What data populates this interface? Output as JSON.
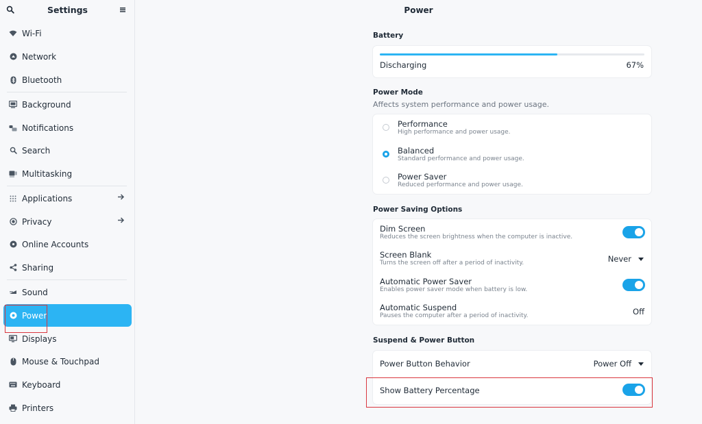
{
  "sidebar": {
    "title": "Settings",
    "items": [
      {
        "id": "wifi",
        "label": "Wi-Fi",
        "icon": "wifi-icon"
      },
      {
        "id": "network",
        "label": "Network",
        "icon": "network-icon"
      },
      {
        "id": "bluetooth",
        "label": "Bluetooth",
        "icon": "bluetooth-icon"
      },
      {
        "id": "background",
        "label": "Background",
        "icon": "background-icon"
      },
      {
        "id": "notifications",
        "label": "Notifications",
        "icon": "notifications-icon"
      },
      {
        "id": "search",
        "label": "Search",
        "icon": "search-icon"
      },
      {
        "id": "multitasking",
        "label": "Multitasking",
        "icon": "multitasking-icon"
      },
      {
        "id": "applications",
        "label": "Applications",
        "icon": "applications-icon"
      },
      {
        "id": "privacy",
        "label": "Privacy",
        "icon": "privacy-icon"
      },
      {
        "id": "online-accounts",
        "label": "Online Accounts",
        "icon": "online-accounts-icon"
      },
      {
        "id": "sharing",
        "label": "Sharing",
        "icon": "sharing-icon"
      },
      {
        "id": "sound",
        "label": "Sound",
        "icon": "sound-icon"
      },
      {
        "id": "power",
        "label": "Power",
        "icon": "power-icon",
        "active": true
      },
      {
        "id": "displays",
        "label": "Displays",
        "icon": "displays-icon"
      },
      {
        "id": "mouse",
        "label": "Mouse & Touchpad",
        "icon": "mouse-icon"
      },
      {
        "id": "keyboard",
        "label": "Keyboard",
        "icon": "keyboard-icon"
      },
      {
        "id": "printers",
        "label": "Printers",
        "icon": "printer-icon"
      }
    ]
  },
  "main": {
    "title": "Power",
    "battery": {
      "section_title": "Battery",
      "status": "Discharging",
      "percent_label": "67%",
      "level": 0.67
    },
    "power_mode": {
      "section_title": "Power Mode",
      "subtitle": "Affects system performance and power usage.",
      "options": [
        {
          "label": "Performance",
          "desc": "High performance and power usage.",
          "selected": false
        },
        {
          "label": "Balanced",
          "desc": "Standard performance and power usage.",
          "selected": true
        },
        {
          "label": "Power Saver",
          "desc": "Reduced performance and power usage.",
          "selected": false
        }
      ]
    },
    "saving": {
      "section_title": "Power Saving Options",
      "dim_screen": {
        "title": "Dim Screen",
        "desc": "Reduces the screen brightness when the computer is inactive.",
        "on": true
      },
      "screen_blank": {
        "title": "Screen Blank",
        "desc": "Turns the screen off after a period of inactivity.",
        "value": "Never"
      },
      "auto_saver": {
        "title": "Automatic Power Saver",
        "desc": "Enables power saver mode when battery is low.",
        "on": true
      },
      "auto_suspend": {
        "title": "Automatic Suspend",
        "desc": "Pauses the computer after a period of inactivity.",
        "value": "Off"
      }
    },
    "suspend": {
      "section_title": "Suspend & Power Button",
      "button_behavior": {
        "title": "Power Button Behavior",
        "value": "Power Off"
      },
      "show_percentage": {
        "title": "Show Battery Percentage",
        "on": true
      }
    }
  },
  "colors": {
    "accent": "#2cb4f3",
    "toggle": "#1aa3e8",
    "highlight": "#d9363e"
  }
}
